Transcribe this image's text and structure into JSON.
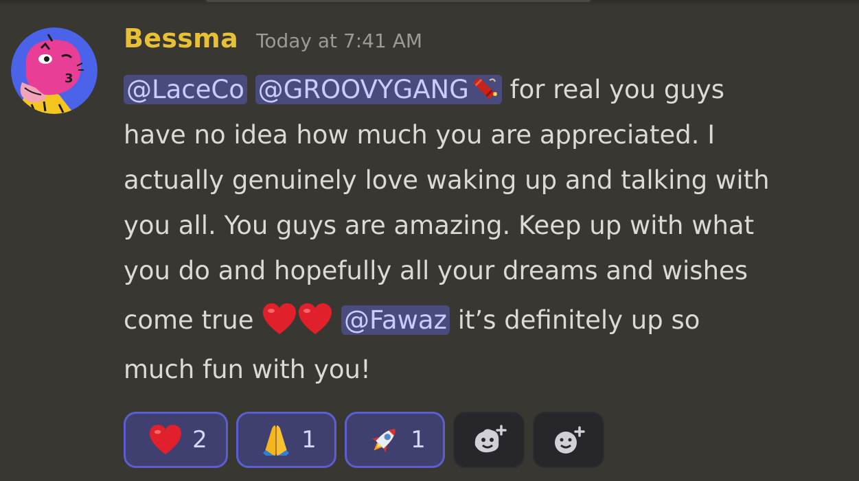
{
  "message": {
    "author": "Bessma",
    "timestamp": "Today at 7:41 AM",
    "lines": {
      "l1_mention1": "@LaceCo",
      "l1_mention2": "@GROOVYGANG",
      "l1_text": " for real you guys",
      "l2": "have no idea how much you are appreciated. I",
      "l3": "actually genuinely love waking up and talking with",
      "l4": "you all. You guys are amazing. Keep up with what",
      "l5": "you do and hopefully all your dreams and wishes",
      "l6_text_a": "come true ",
      "l6_mention": "@Fawaz",
      "l6_text_b": " it’s definitely up so",
      "l7": "much fun with you!"
    }
  },
  "reactions": [
    {
      "emoji": "red-heart-icon",
      "count": "2",
      "active": true
    },
    {
      "emoji": "folded-hands-icon",
      "count": "1",
      "active": true
    },
    {
      "emoji": "rocket-icon",
      "count": "1",
      "active": true
    }
  ],
  "add_reaction_buttons": [
    "add-super-reaction-icon",
    "add-reaction-icon"
  ],
  "colors": {
    "background": "#383731",
    "username": "#e7c036",
    "mention_bg": "#4a4b7d",
    "reaction_active_border": "#5b5fcf"
  }
}
